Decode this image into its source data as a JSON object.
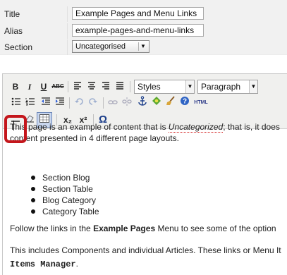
{
  "form": {
    "title_label": "Title",
    "title_value": "Example Pages and Menu Links",
    "alias_label": "Alias",
    "alias_value": "example-pages-and-menu-links",
    "section_label": "Section",
    "section_value": "Uncategorised"
  },
  "toolbar": {
    "row1": {
      "bold": "B",
      "italic": "I",
      "underline": "U",
      "strike": "ABC",
      "styles": "Styles",
      "format": "Paragraph"
    },
    "row2": {
      "html": "HTML"
    },
    "row3": {
      "subscript": "x₂",
      "superscript": "x²",
      "charmap": "Ω"
    }
  },
  "content": {
    "p1_pre": "This page is an example of content that is ",
    "p1_em": "Uncategorized",
    "p1_post": "; that is, it does",
    "p1_line2": "content presented in 4 different page layouts.",
    "list": [
      "Section Blog",
      "Section Table",
      "Blog Category",
      "Category Table"
    ],
    "p2_pre": "Follow the links in the ",
    "p2_bold": "Example Pages",
    "p2_post": " Menu to see some of the option",
    "p3_line1": "This includes Components and individual Articles. These links or Menu It",
    "p3_line2_mono": "Items Manager",
    "p3_line2_post": "."
  },
  "colors": {
    "callout": "#c4161c",
    "selected_button": "#c9d7ef"
  }
}
